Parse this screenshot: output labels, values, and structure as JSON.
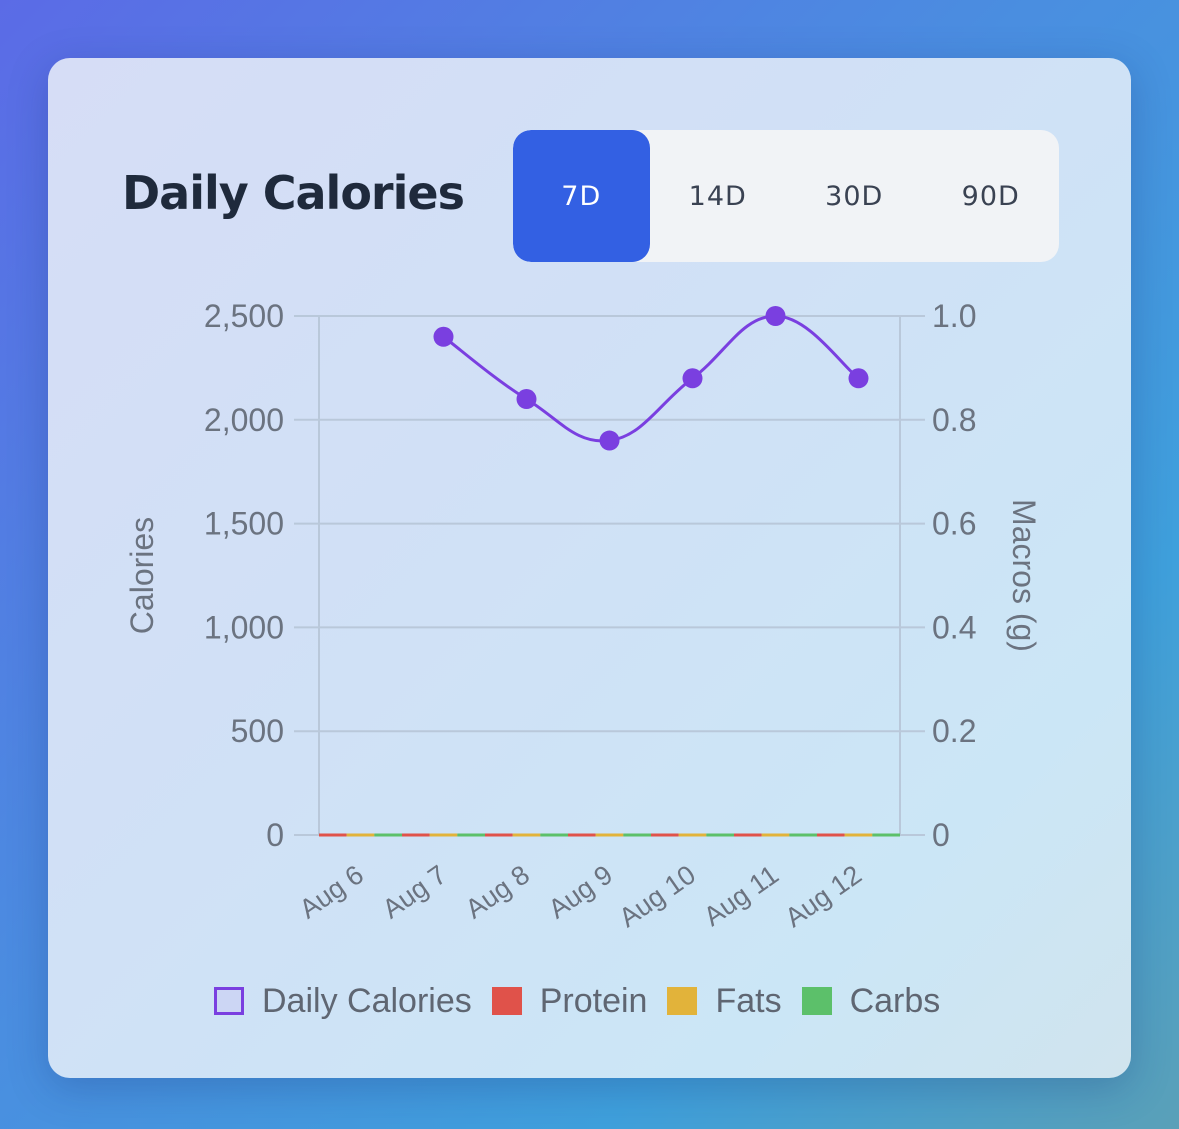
{
  "header": {
    "title": "Daily Calories",
    "ranges": [
      "7D",
      "14D",
      "30D",
      "90D"
    ],
    "active_range": "7D"
  },
  "colors": {
    "calories": "#7a3fe0",
    "protein": "#e0524a",
    "fats": "#e2b33a",
    "carbs": "#5cc06a",
    "active_button": "#3360e3"
  },
  "chart_data": {
    "type": "line",
    "categories": [
      "Aug 6",
      "Aug 7",
      "Aug 8",
      "Aug 9",
      "Aug 10",
      "Aug 11",
      "Aug 12"
    ],
    "series": [
      {
        "name": "Daily Calories",
        "axis": "left",
        "values": [
          null,
          2400,
          2100,
          1900,
          2200,
          2500,
          2200
        ]
      },
      {
        "name": "Protein",
        "axis": "right",
        "values": [
          0,
          0,
          0,
          0,
          0,
          0,
          0
        ]
      },
      {
        "name": "Fats",
        "axis": "right",
        "values": [
          0,
          0,
          0,
          0,
          0,
          0,
          0
        ]
      },
      {
        "name": "Carbs",
        "axis": "right",
        "values": [
          0,
          0,
          0,
          0,
          0,
          0,
          0
        ]
      }
    ],
    "ylabel": "Calories",
    "y2label": "Macros (g)",
    "ylim": [
      0,
      2500
    ],
    "y2lim": [
      0,
      1.0
    ],
    "yticks": [
      "0",
      "500",
      "1,000",
      "1,500",
      "2,000",
      "2,500"
    ],
    "y2ticks": [
      "0",
      "0.2",
      "0.4",
      "0.6",
      "0.8",
      "1.0"
    ],
    "grid": true,
    "legend_position": "bottom"
  }
}
